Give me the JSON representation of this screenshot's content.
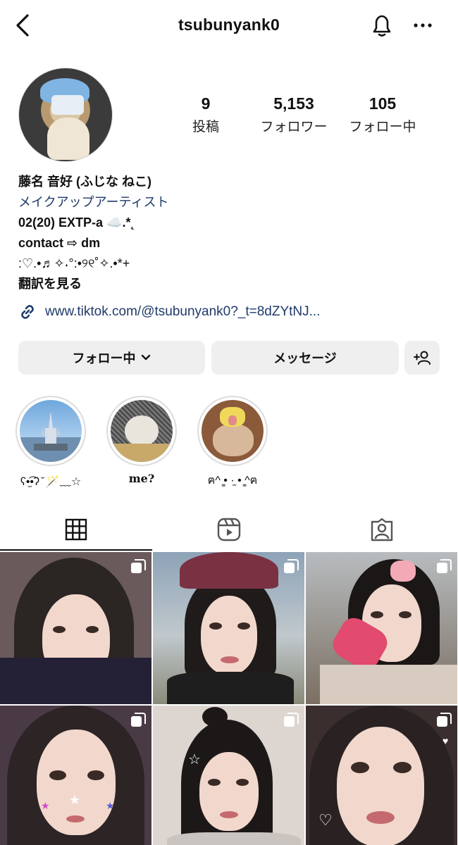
{
  "header": {
    "username": "tsubunyank0"
  },
  "profile": {
    "stats": [
      {
        "count": "9",
        "label": "投稿"
      },
      {
        "count": "5,153",
        "label": "フォロワー"
      },
      {
        "count": "105",
        "label": "フォロー中"
      }
    ],
    "name": "藤名 音好 (ふじな ねこ)",
    "category": "メイクアップアーティスト",
    "bio_lines": [
      "02(20) EXTP-a ☁️.*˛",
      "contact ⇨ dm",
      ":♡.•♬✧˖°:•୨୧˚✧.•*+"
    ],
    "translate": "翻訳を見る",
    "link": "www.tiktok.com/@tsubunyank0?_t=8dZYtNJ..."
  },
  "actions": {
    "follow_label": "フォロー中",
    "message_label": "メッセージ"
  },
  "highlights": [
    {
      "caption": "ʕ•̫͡•ʔ ̆ 🪄﹏☆"
    },
    {
      "caption": "me?"
    },
    {
      "caption": "ฅ^ ̳• ·̫ • ̳^ฅ"
    }
  ],
  "colors": {
    "link": "#1f3a6a",
    "button_bg": "#efefef"
  }
}
